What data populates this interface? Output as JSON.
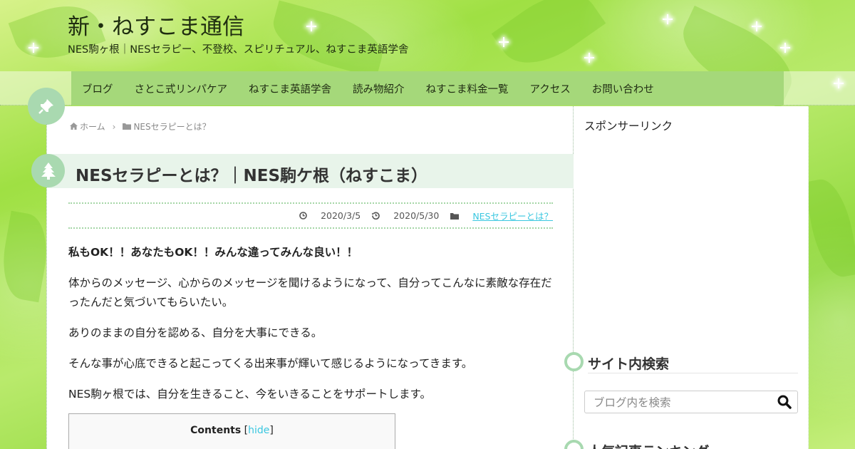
{
  "site": {
    "title": "新・ねすこま通信",
    "description": "NES駒ヶ根｜NESセラピー、不登校、スピリチュアル、ねすこま英語学舎"
  },
  "nav": {
    "items": [
      {
        "label": "ブログ"
      },
      {
        "label": "さとこ式リンパケア"
      },
      {
        "label": "ねすこま英語学舎"
      },
      {
        "label": "読み物紹介"
      },
      {
        "label": "ねすこま料金一覧"
      },
      {
        "label": "アクセス"
      },
      {
        "label": "お問い合わせ"
      }
    ]
  },
  "breadcrumb": {
    "home": "ホーム",
    "category": "NESセラピーとは？"
  },
  "post": {
    "title": "NESセラピーとは？｜NES駒ケ根（ねすこま）",
    "published": "2020/3/5",
    "updated": "2020/5/30",
    "category": "NESセラピーとは？",
    "paragraphs": [
      "私もOK！！あなたもOK！！みんな違ってみんな良い！！",
      "体からのメッセージ、心からのメッセージを聞けるようになって、自分ってこんなに素敵な存在だったんだと気づいてもらいたい。",
      "ありのままの自分を認める、自分を大事にできる。",
      "そんな事が心底できると起こってくる出来事が輝いて感じるようになってきます。",
      "NES駒ヶ根では、自分を生きること、今をいきることをサポートします。"
    ]
  },
  "toc": {
    "title": "Contents",
    "toggle_open": "[",
    "toggle": "hide",
    "toggle_close": "]"
  },
  "sidebar": {
    "sponsor": "スポンサーリンク",
    "search_title": "サイト内検索",
    "search_placeholder": "ブログ内を検索",
    "ranking_title": "人気記事ランキング"
  },
  "colors": {
    "nav_bg": "#a5d87a",
    "accent_link": "#3ac7e0",
    "badge": "#a9d9b0",
    "title_band": "#e8f4ea"
  },
  "icons": {
    "home": "home-icon",
    "folder": "folder-icon",
    "clock": "clock-icon",
    "history": "history-icon",
    "pin": "pin-icon",
    "tree": "tree-icon",
    "search": "search-icon"
  }
}
